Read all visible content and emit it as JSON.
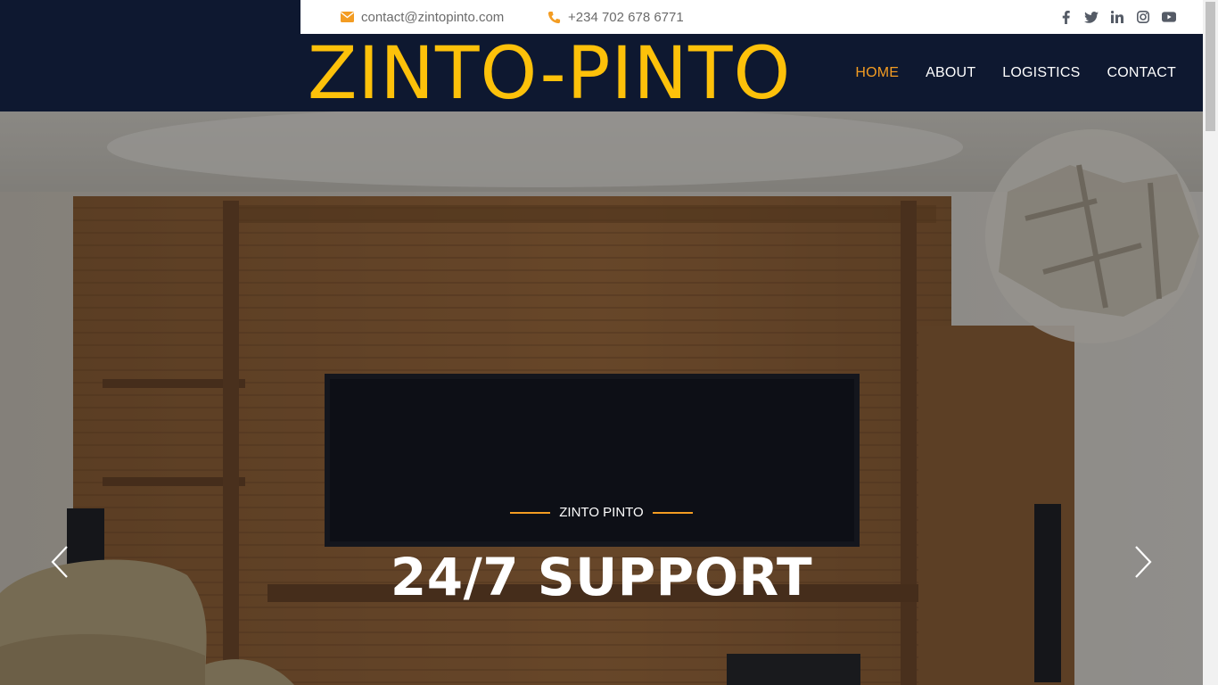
{
  "topbar": {
    "email": "contact@zintopinto.com",
    "phone": "+234 702 678 6771",
    "socials": [
      "facebook-icon",
      "twitter-icon",
      "linkedin-icon",
      "instagram-icon",
      "youtube-icon"
    ]
  },
  "brand": {
    "logo_text": "ZINTO-PINTO",
    "logo_color": "#fdc10a",
    "accent": "#f39c22",
    "nav_bg": "#0e1830"
  },
  "nav": {
    "items": [
      {
        "label": "HOME",
        "active": true
      },
      {
        "label": "ABOUT",
        "active": false
      },
      {
        "label": "LOGISTICS",
        "active": false
      },
      {
        "label": "CONTACT",
        "active": false
      }
    ]
  },
  "hero": {
    "subtitle": "ZINTO PINTO",
    "title": "24/7 SUPPORT",
    "prev_icon": "chevron-left-icon",
    "next_icon": "chevron-right-icon"
  }
}
